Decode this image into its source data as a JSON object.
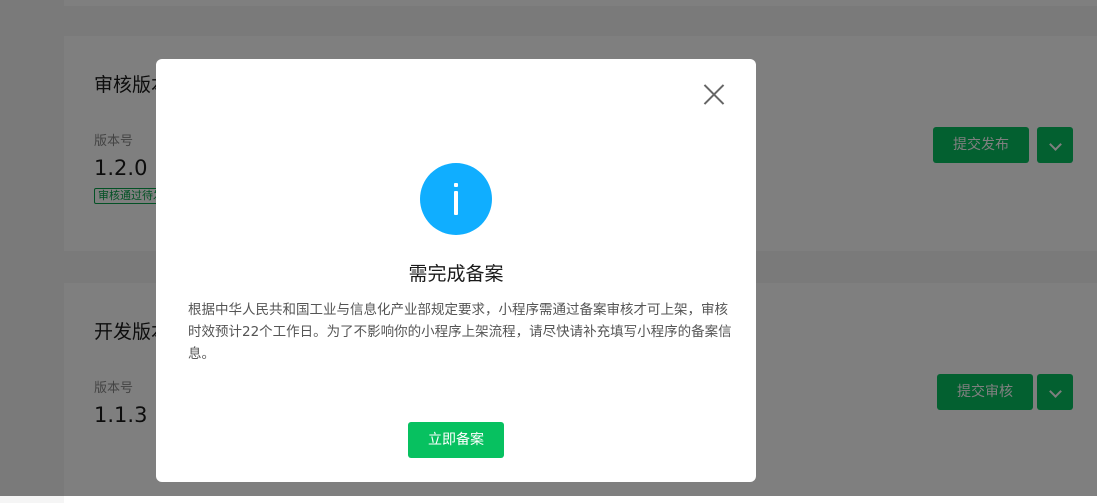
{
  "review_card": {
    "title": "审核版本",
    "version_label": "版本号",
    "version_value": "1.2.0",
    "status_tag": "审核通过待发布",
    "primary_button": "提交发布"
  },
  "dev_card": {
    "title": "开发版本",
    "version_label": "版本号",
    "version_value": "1.1.3",
    "primary_button": "提交审核"
  },
  "modal": {
    "icon": "info-icon",
    "title": "需完成备案",
    "description": "根据中华人民共和国工业与信息化产业部规定要求，小程序需通过备案审核才可上架，审核时效预计22个工作日。为了不影响你的小程序上架流程，请尽快请补充填写小程序的备案信息。",
    "action_button": "立即备案",
    "close_icon": "close-icon"
  },
  "colors": {
    "accent_green": "#07c160",
    "info_blue": "#10aeff",
    "overlay": "rgba(0,0,0,0.5)"
  }
}
